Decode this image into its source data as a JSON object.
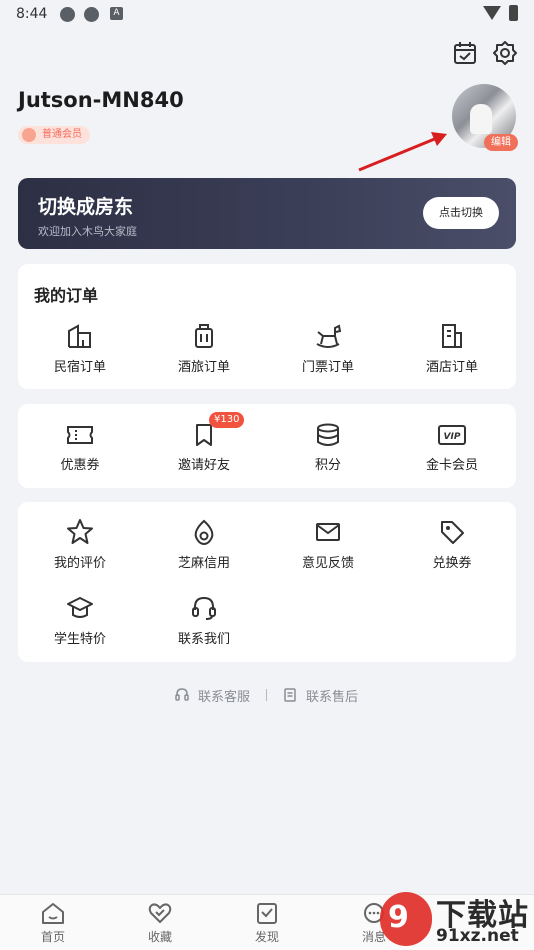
{
  "status_bar": {
    "time": "8:44",
    "notif_letter": "A"
  },
  "header_icons": {
    "calendar": "calendar-check-icon",
    "settings": "gear-icon"
  },
  "profile": {
    "username": "Jutson-MN840",
    "member_level": "普通会员",
    "avatar_edit_label": "编辑"
  },
  "banner": {
    "title": "切换成房东",
    "subtitle": "欢迎加入木鸟大家庭",
    "button_label": "点击切换"
  },
  "orders": {
    "title": "我的订单",
    "items": [
      {
        "label": "民宿订单",
        "icon": "house-icon"
      },
      {
        "label": "酒旅订单",
        "icon": "luggage-icon"
      },
      {
        "label": "门票订单",
        "icon": "rocking-horse-icon"
      },
      {
        "label": "酒店订单",
        "icon": "hotel-icon"
      }
    ]
  },
  "benefits": {
    "items": [
      {
        "label": "优惠券",
        "icon": "ticket-icon"
      },
      {
        "label": "邀请好友",
        "icon": "bookmark-icon",
        "badge": "¥130"
      },
      {
        "label": "积分",
        "icon": "coin-stack-icon"
      },
      {
        "label": "金卡会员",
        "icon": "vip-icon",
        "icon_text": "VIP"
      }
    ]
  },
  "services": {
    "items": [
      {
        "label": "我的评价",
        "icon": "star-icon"
      },
      {
        "label": "芝麻信用",
        "icon": "sesame-credit-icon"
      },
      {
        "label": "意见反馈",
        "icon": "envelope-icon"
      },
      {
        "label": "兑换券",
        "icon": "tag-icon"
      },
      {
        "label": "学生特价",
        "icon": "graduation-cap-icon"
      },
      {
        "label": "联系我们",
        "icon": "headset-icon"
      }
    ]
  },
  "footer_links": {
    "customer_service": "联系客服",
    "after_sales": "联系售后"
  },
  "tab_bar": {
    "tabs": [
      {
        "label": "首页",
        "icon": "home-icon"
      },
      {
        "label": "收藏",
        "icon": "heart-icon"
      },
      {
        "label": "发现",
        "icon": "discover-icon"
      },
      {
        "label": "消息",
        "icon": "message-icon"
      }
    ]
  },
  "watermark": {
    "text": "下载站",
    "url": "91xz.net"
  },
  "colors": {
    "accent": "#f1705a",
    "banner_bg": "#2d3044",
    "page_bg": "#f1f3f7",
    "badge": "#f1533e",
    "watermark_red": "#e0302a"
  }
}
